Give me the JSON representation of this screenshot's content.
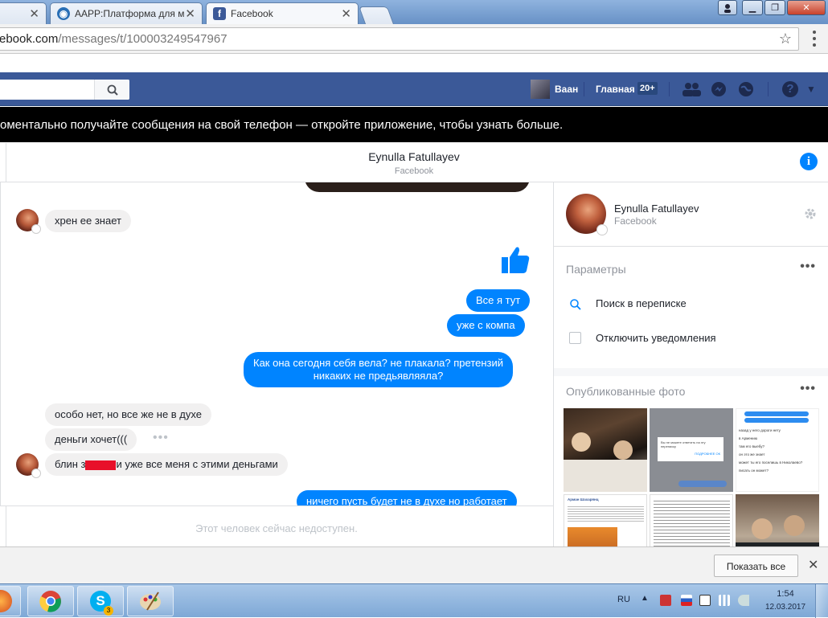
{
  "browser": {
    "tabs": [
      {
        "label": "",
        "favicon": "facebook"
      },
      {
        "label": "AAPP:Платформа для м",
        "favicon": "aapp-globe"
      },
      {
        "label": "Facebook",
        "favicon": "facebook"
      }
    ],
    "url_domain": "ebook.com",
    "url_path": "/messages/t/100003249547967",
    "bookmark_icon": "star-icon"
  },
  "fb_header": {
    "user_name": "Ваан",
    "home_label": "Главная",
    "home_count": "20+",
    "brand_color": "#3b5998"
  },
  "banner": {
    "text": "оментально получайте сообщения на свой телефон — откройте приложение, чтобы узнать больше."
  },
  "conversation": {
    "name": "Eynulla Fatullayev",
    "subtitle": "Facebook",
    "info_icon": "info-icon"
  },
  "messages": [
    {
      "dir": "in",
      "text": "хрен ее знает"
    },
    {
      "dir": "out",
      "text": "like-thumb"
    },
    {
      "dir": "out",
      "text": "Все я тут"
    },
    {
      "dir": "out",
      "text": "уже с компа"
    },
    {
      "dir": "out",
      "text": "Как она сегодня себя вела? не плакала? претензий",
      "text2": "никаких не предьявляяла?"
    },
    {
      "dir": "in",
      "text": "особо нет, но все же не в духе"
    },
    {
      "dir": "in",
      "text": "деньги хочет((("
    },
    {
      "dir": "in",
      "text_a": "блин з",
      "text_b": "и уже все меня с этими деньгами"
    },
    {
      "dir": "out",
      "text": "ничего пусть будет не в духе но работает"
    }
  ],
  "compose": {
    "placeholder": "Этот человек сейчас недоступен."
  },
  "right_panel": {
    "name": "Eynulla Fatullayev",
    "subtitle": "Facebook",
    "params_title": "Параметры",
    "search_label": "Поиск в переписке",
    "mute_label": "Отключить уведомления",
    "photos_title": "Опубликованные фото"
  },
  "photo_texts": {
    "p2_line1": "Вы не можете ответить на эту",
    "p2_line2": "переписку",
    "p2_link1": "ПОДРОБНЕЕ",
    "p2_link2": "ОК",
    "p3_lines": [
      "назад у него дороги нету",
      "в Армению",
      "там его выебу?",
      "он это же знает",
      "может ты его поселишь в Николаево?",
      "писать он может?"
    ],
    "p4_author": "Арман Шахарянц"
  },
  "download_bar": {
    "show_all": "Показать все"
  },
  "taskbar": {
    "lang": "RU",
    "time": "1:54",
    "date": "12.03.2017",
    "skype_badge": "3"
  }
}
